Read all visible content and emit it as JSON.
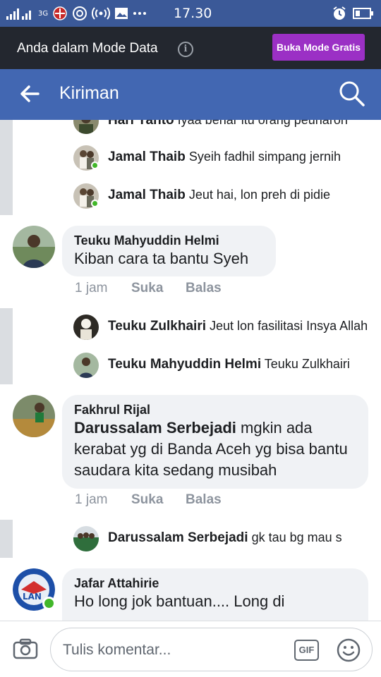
{
  "status_bar": {
    "time": "17.30",
    "network_label": "3G",
    "colors": {
      "background": "#3b5998"
    }
  },
  "data_mode_bar": {
    "message": "Anda dalam Mode Data",
    "button_label": "Buka Mode Gratis",
    "colors": {
      "background": "#23272f",
      "button": "#9b30c5"
    }
  },
  "header": {
    "title": "Kiriman",
    "colors": {
      "background": "#4267b2"
    }
  },
  "comments": [
    {
      "type": "reply",
      "author": "Hari Yanto",
      "text": "Iyaa benar itu orang peunaron"
    },
    {
      "type": "reply",
      "author": "Jamal Thaib",
      "text": "Syeih fadhil simpang jernih",
      "online": true
    },
    {
      "type": "reply",
      "author": "Jamal Thaib",
      "text": "Jeut hai, lon preh di pidie",
      "online": true
    },
    {
      "type": "comment",
      "author": "Teuku Mahyuddin Helmi",
      "text": "Kiban cara ta bantu Syeh",
      "time": "1 jam",
      "like": "Suka",
      "reply": "Balas"
    },
    {
      "type": "reply",
      "author": "Teuku Zulkhairi",
      "text": "Jeut lon fasilitasi Insya Allah"
    },
    {
      "type": "reply",
      "author": "Teuku Mahyuddin Helmi",
      "text": "Teuku Zulkhairi"
    },
    {
      "type": "comment",
      "author": "Fakhrul Rijal",
      "mention": "Darussalam Serbejadi",
      "text": " mgkin ada kerabat yg di Banda Aceh yg bisa bantu saudara kita sedang musibah",
      "time": "1 jam",
      "like": "Suka",
      "reply": "Balas"
    },
    {
      "type": "reply",
      "author": "Darussalam Serbejadi",
      "text": "gk tau bg mau s"
    },
    {
      "type": "comment",
      "author": "Jafar Attahirie",
      "text": "Ho long jok bantuan.... Long di",
      "online": true
    }
  ],
  "footer": {
    "placeholder": "Tulis komentar...",
    "gif_label": "GIF"
  }
}
